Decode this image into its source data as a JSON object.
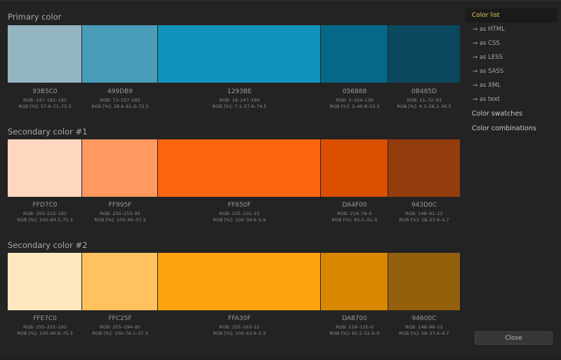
{
  "sections": [
    {
      "title": "Primary color",
      "swatches": [
        {
          "hex": "93B5C0",
          "rgb": "RGB: 147–181–192",
          "rgbp": "RGB [%]: 57.6–71–75.3",
          "color": "#93B5C0"
        },
        {
          "hex": "499DB9",
          "rgb": "RGB: 73–157–185",
          "rgbp": "RGB [%]: 28.6–61.6–72.5",
          "color": "#499DB9"
        },
        {
          "hex": "1293BE",
          "rgb": "RGB: 18–147–190",
          "rgbp": "RGB [%]: 7.1–57.6–74.5",
          "color": "#1293BE"
        },
        {
          "hex": "056888",
          "rgb": "RGB: 5–104–136",
          "rgbp": "RGB [%]: 2–40.8–53.3",
          "color": "#056888"
        },
        {
          "hex": "0B485D",
          "rgb": "RGB: 11–72–93",
          "rgbp": "RGB [%]: 4.3–28.2–36.5",
          "color": "#0B485D"
        }
      ]
    },
    {
      "title": "Secondary color #1",
      "swatches": [
        {
          "hex": "FFD7C0",
          "rgb": "RGB: 255–215–192",
          "rgbp": "RGB [%]: 100–84.3–75.3",
          "color": "#FFD7C0"
        },
        {
          "hex": "FF995F",
          "rgb": "RGB: 255–153–95",
          "rgbp": "RGB [%]: 100–60–37.3",
          "color": "#FF995F"
        },
        {
          "hex": "FF650F",
          "rgb": "RGB: 255–101–15",
          "rgbp": "RGB [%]: 100–39.6–5.9",
          "color": "#FF650F"
        },
        {
          "hex": "DA4F00",
          "rgb": "RGB: 218–79–0",
          "rgbp": "RGB [%]: 85.5–31–0",
          "color": "#DA4F00"
        },
        {
          "hex": "943D0C",
          "rgb": "RGB: 148–61–12",
          "rgbp": "RGB [%]: 58–23.9–4.7",
          "color": "#943D0C"
        }
      ]
    },
    {
      "title": "Secondary color #2",
      "swatches": [
        {
          "hex": "FFE7C0",
          "rgb": "RGB: 255–231–192",
          "rgbp": "RGB [%]: 100–90.6–75.3",
          "color": "#FFE7C0"
        },
        {
          "hex": "FFC25F",
          "rgb": "RGB: 255–194–95",
          "rgbp": "RGB [%]: 100–76.1–37.3",
          "color": "#FFC25F"
        },
        {
          "hex": "FFA30F",
          "rgb": "RGB: 255–163–15",
          "rgbp": "RGB [%]: 100–63.9–5.9",
          "color": "#FFA30F"
        },
        {
          "hex": "DA8700",
          "rgb": "RGB: 218–135–0",
          "rgbp": "RGB [%]: 85.5–52.9–0",
          "color": "#DA8700"
        },
        {
          "hex": "94600C",
          "rgb": "RGB: 148–96–12",
          "rgbp": "RGB [%]: 58–37.6–4.7",
          "color": "#94600C"
        }
      ]
    }
  ],
  "sidebar": {
    "items": [
      {
        "label": "Color list",
        "kind": "active"
      },
      {
        "label": "→ as HTML",
        "kind": "sub"
      },
      {
        "label": "→ as CSS",
        "kind": "sub"
      },
      {
        "label": "→ as LESS",
        "kind": "sub"
      },
      {
        "label": "→ as SASS",
        "kind": "sub"
      },
      {
        "label": "→ as XML",
        "kind": "sub"
      },
      {
        "label": "→ as text",
        "kind": "sub"
      },
      {
        "label": "Color swatches",
        "kind": "big"
      },
      {
        "label": "Color combinations",
        "kind": "big"
      }
    ]
  },
  "close_label": "Close",
  "colors": {
    "background": "#232323",
    "accent": "#E8C65A"
  }
}
